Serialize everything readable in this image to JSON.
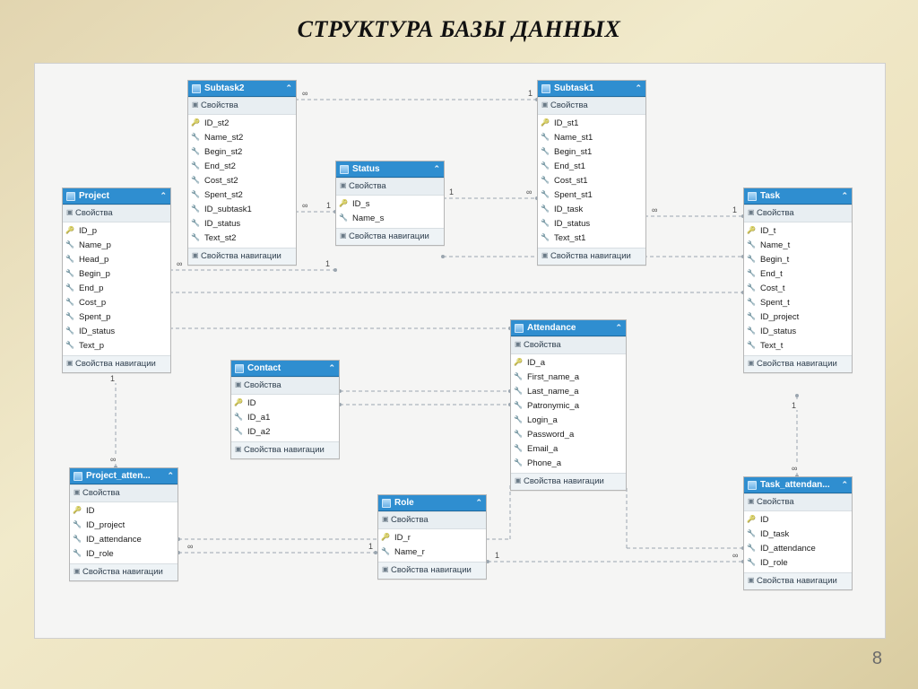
{
  "title": "СТРУКТУРА БАЗЫ ДАННЫХ",
  "page_number": "8",
  "labels": {
    "properties": "Свойства",
    "navigation": "Свойства навигации"
  },
  "entities": {
    "project": {
      "name": "Project",
      "fields": [
        {
          "name": "ID_p",
          "pk": true
        },
        {
          "name": "Name_p",
          "pk": false
        },
        {
          "name": "Head_p",
          "pk": false
        },
        {
          "name": "Begin_p",
          "pk": false
        },
        {
          "name": "End_p",
          "pk": false
        },
        {
          "name": "Cost_p",
          "pk": false
        },
        {
          "name": "Spent_p",
          "pk": false
        },
        {
          "name": "ID_status",
          "pk": false
        },
        {
          "name": "Text_p",
          "pk": false
        }
      ]
    },
    "subtask2": {
      "name": "Subtask2",
      "fields": [
        {
          "name": "ID_st2",
          "pk": true
        },
        {
          "name": "Name_st2",
          "pk": false
        },
        {
          "name": "Begin_st2",
          "pk": false
        },
        {
          "name": "End_st2",
          "pk": false
        },
        {
          "name": "Cost_st2",
          "pk": false
        },
        {
          "name": "Spent_st2",
          "pk": false
        },
        {
          "name": "ID_subtask1",
          "pk": false
        },
        {
          "name": "ID_status",
          "pk": false
        },
        {
          "name": "Text_st2",
          "pk": false
        }
      ]
    },
    "status": {
      "name": "Status",
      "fields": [
        {
          "name": "ID_s",
          "pk": true
        },
        {
          "name": "Name_s",
          "pk": false
        }
      ]
    },
    "subtask1": {
      "name": "Subtask1",
      "fields": [
        {
          "name": "ID_st1",
          "pk": true
        },
        {
          "name": "Name_st1",
          "pk": false
        },
        {
          "name": "Begin_st1",
          "pk": false
        },
        {
          "name": "End_st1",
          "pk": false
        },
        {
          "name": "Cost_st1",
          "pk": false
        },
        {
          "name": "Spent_st1",
          "pk": false
        },
        {
          "name": "ID_task",
          "pk": false
        },
        {
          "name": "ID_status",
          "pk": false
        },
        {
          "name": "Text_st1",
          "pk": false
        }
      ]
    },
    "task": {
      "name": "Task",
      "fields": [
        {
          "name": "ID_t",
          "pk": true
        },
        {
          "name": "Name_t",
          "pk": false
        },
        {
          "name": "Begin_t",
          "pk": false
        },
        {
          "name": "End_t",
          "pk": false
        },
        {
          "name": "Cost_t",
          "pk": false
        },
        {
          "name": "Spent_t",
          "pk": false
        },
        {
          "name": "ID_project",
          "pk": false
        },
        {
          "name": "ID_status",
          "pk": false
        },
        {
          "name": "Text_t",
          "pk": false
        }
      ]
    },
    "contact": {
      "name": "Contact",
      "fields": [
        {
          "name": "ID",
          "pk": true
        },
        {
          "name": "ID_a1",
          "pk": false
        },
        {
          "name": "ID_a2",
          "pk": false
        }
      ]
    },
    "attendance": {
      "name": "Attendance",
      "fields": [
        {
          "name": "ID_a",
          "pk": true
        },
        {
          "name": "First_name_a",
          "pk": false
        },
        {
          "name": "Last_name_a",
          "pk": false
        },
        {
          "name": "Patronymic_a",
          "pk": false
        },
        {
          "name": "Login_a",
          "pk": false
        },
        {
          "name": "Password_a",
          "pk": false
        },
        {
          "name": "Email_a",
          "pk": false
        },
        {
          "name": "Phone_a",
          "pk": false
        }
      ]
    },
    "project_attendance": {
      "name": "Project_atten...",
      "fields": [
        {
          "name": "ID",
          "pk": true
        },
        {
          "name": "ID_project",
          "pk": false
        },
        {
          "name": "ID_attendance",
          "pk": false
        },
        {
          "name": "ID_role",
          "pk": false
        }
      ]
    },
    "role": {
      "name": "Role",
      "fields": [
        {
          "name": "ID_r",
          "pk": true
        },
        {
          "name": "Name_r",
          "pk": false
        }
      ]
    },
    "task_attendance": {
      "name": "Task_attendan...",
      "fields": [
        {
          "name": "ID",
          "pk": true
        },
        {
          "name": "ID_task",
          "pk": false
        },
        {
          "name": "ID_attendance",
          "pk": false
        },
        {
          "name": "ID_role",
          "pk": false
        }
      ]
    }
  },
  "relations": [
    {
      "from": "Subtask2",
      "to": "Status",
      "card_from": "∞",
      "card_to": "1"
    },
    {
      "from": "Subtask1",
      "to": "Status",
      "card_from": "∞",
      "card_to": "1"
    },
    {
      "from": "Project",
      "to": "Status",
      "card_from": "∞",
      "card_to": "1"
    },
    {
      "from": "Task",
      "to": "Status",
      "card_from": "∞",
      "card_to": "1"
    },
    {
      "from": "Subtask2",
      "to": "Subtask1",
      "card_from": "∞",
      "card_to": "1"
    },
    {
      "from": "Subtask1",
      "to": "Task",
      "card_from": "∞",
      "card_to": "1"
    },
    {
      "from": "Task",
      "to": "Project",
      "card_from": "∞",
      "card_to": "1"
    },
    {
      "from": "Project_attendance",
      "to": "Project",
      "card_from": "∞",
      "card_to": "1"
    },
    {
      "from": "Project_attendance",
      "to": "Attendance",
      "card_from": "∞",
      "card_to": "1"
    },
    {
      "from": "Project_attendance",
      "to": "Role",
      "card_from": "∞",
      "card_to": "1"
    },
    {
      "from": "Task_attendance",
      "to": "Task",
      "card_from": "∞",
      "card_to": "1"
    },
    {
      "from": "Task_attendance",
      "to": "Attendance",
      "card_from": "∞",
      "card_to": "1"
    },
    {
      "from": "Task_attendance",
      "to": "Role",
      "card_from": "∞",
      "card_to": "1"
    },
    {
      "from": "Contact",
      "to": "Attendance",
      "card_from": "∞",
      "card_to": "1"
    },
    {
      "from": "Contact",
      "to": "Attendance",
      "card_from": "∞",
      "card_to": "1"
    },
    {
      "from": "Project",
      "to": "Attendance",
      "card_from": "∞",
      "card_to": "1"
    }
  ]
}
